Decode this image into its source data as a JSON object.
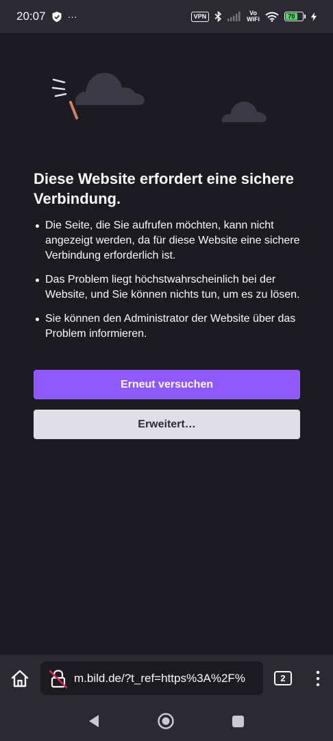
{
  "status_bar": {
    "time": "20:07",
    "more": "···",
    "vpn": "VPN",
    "vowifi_top": "Vo",
    "vowifi_bottom": "WiFi",
    "battery": "70"
  },
  "error": {
    "title": "Diese Website erfordert eine sichere Verbindung.",
    "bullets": [
      "Die Seite, die Sie aufrufen möchten, kann nicht angezeigt werden, da für diese Website eine sichere Verbindung erforderlich ist.",
      "Das Problem liegt höchstwahrscheinlich bei der Website, und Sie können nichts tun, um es zu lösen.",
      "Sie können den Administrator der Website über das Problem informieren."
    ],
    "retry_label": "Erneut versuchen",
    "advanced_label": "Erweitert…"
  },
  "toolbar": {
    "url": "m.bild.de/?t_ref=https%3A%2F%",
    "tab_count": "2"
  },
  "colors": {
    "background": "#1c1b22",
    "toolbar": "#2b2a33",
    "primary_button": "#9059ff",
    "secondary_button": "#e0dfe6"
  }
}
